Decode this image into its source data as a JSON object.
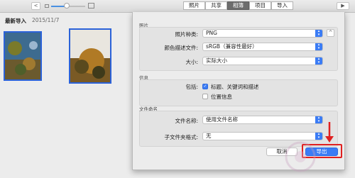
{
  "toolbar": {
    "back_glyph": "<",
    "zoom_fraction": 0.45,
    "tabs": [
      {
        "label": "照片",
        "active": false
      },
      {
        "label": "共享",
        "active": false
      },
      {
        "label": "相簿",
        "active": true
      },
      {
        "label": "项目",
        "active": false
      },
      {
        "label": "导入",
        "active": false
      }
    ],
    "play_glyph": "▶"
  },
  "content": {
    "section_title": "最新导入",
    "date": "2015/11/7"
  },
  "export_sheet": {
    "photo_section_title": "照片",
    "photo_type_label": "照片种类:",
    "photo_type_value": "PNG",
    "expand_glyph": "^",
    "color_profile_label": "颜色描述文件:",
    "color_profile_value": "sRGB（兼容性最好）",
    "size_label": "大小:",
    "size_value": "实际大小",
    "info_section_title": "信息",
    "include_label": "包括:",
    "include_options": [
      {
        "label": "标题、关键词和描述",
        "checked": true
      },
      {
        "label": "位置信息",
        "checked": false
      }
    ],
    "filename_section_title": "文件命名",
    "filename_label": "文件名称:",
    "filename_value": "使用文件名称",
    "subfolder_label": "子文件夹格式:",
    "subfolder_value": "无",
    "cancel_label": "取消",
    "export_label": "导出"
  },
  "colors": {
    "accent": "#3b7cf5",
    "annotation": "#e02020"
  },
  "icons": {
    "play": "play-icon",
    "back": "chevron-left-icon",
    "arrow": "red-down-arrow-annotation",
    "checkmark": "checkmark-icon"
  }
}
